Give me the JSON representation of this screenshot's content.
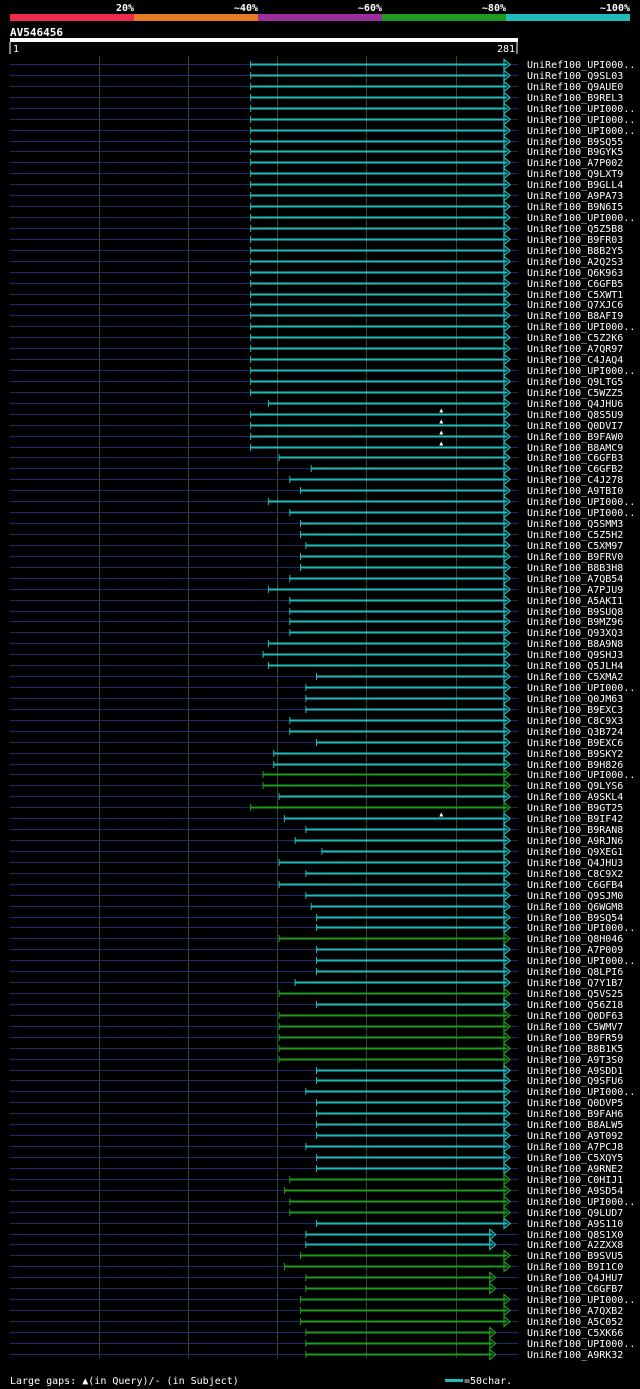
{
  "chart_data": {
    "type": "alignment-overview",
    "query_name": "AV546456",
    "query_start": 1,
    "query_end": 281,
    "start_label": "1",
    "end_label": "281",
    "identity_scale": {
      "ticks": [
        "20%",
        "~40%",
        "~60%",
        "~80%",
        "~100%"
      ],
      "colors": [
        "#ee2b4a",
        "#e87a22",
        "#9b2f9d",
        "#1f9a1f",
        "#1fbcbc"
      ]
    },
    "colors": {
      "background": "#000000",
      "query_bar": "#ffffff",
      "unaligned_line": "#1c2a6e",
      "grid": "#2a4f2a"
    },
    "hits": [
      {
        "name": "UniRef100_UPI000..",
        "start": 136,
        "end": 281,
        "color": "cyan",
        "arrow": true
      },
      {
        "name": "UniRef100_Q9SL03",
        "start": 136,
        "end": 281,
        "color": "cyan",
        "arrow": true
      },
      {
        "name": "UniRef100_Q9AUE0",
        "start": 136,
        "end": 281,
        "color": "cyan",
        "arrow": true
      },
      {
        "name": "UniRef100_B9REL3",
        "start": 136,
        "end": 281,
        "color": "cyan",
        "arrow": true
      },
      {
        "name": "UniRef100_UPI000..",
        "start": 136,
        "end": 281,
        "color": "cyan",
        "arrow": true
      },
      {
        "name": "UniRef100_UPI000..",
        "start": 136,
        "end": 281,
        "color": "cyan",
        "arrow": true
      },
      {
        "name": "UniRef100_UPI000..",
        "start": 136,
        "end": 281,
        "color": "cyan",
        "arrow": true
      },
      {
        "name": "UniRef100_B9SQ55",
        "start": 136,
        "end": 281,
        "color": "cyan",
        "arrow": true
      },
      {
        "name": "UniRef100_B9GYK5",
        "start": 136,
        "end": 281,
        "color": "cyan",
        "arrow": true
      },
      {
        "name": "UniRef100_A7P002",
        "start": 136,
        "end": 281,
        "color": "cyan",
        "arrow": true
      },
      {
        "name": "UniRef100_Q9LXT9",
        "start": 136,
        "end": 281,
        "color": "cyan",
        "arrow": true
      },
      {
        "name": "UniRef100_B9GLL4",
        "start": 136,
        "end": 281,
        "color": "cyan",
        "arrow": true
      },
      {
        "name": "UniRef100_A9PA73",
        "start": 136,
        "end": 281,
        "color": "cyan",
        "arrow": true
      },
      {
        "name": "UniRef100_B9N6I5",
        "start": 136,
        "end": 281,
        "color": "cyan",
        "arrow": true
      },
      {
        "name": "UniRef100_UPI000..",
        "start": 136,
        "end": 281,
        "color": "cyan",
        "arrow": true
      },
      {
        "name": "UniRef100_Q5Z5B8",
        "start": 136,
        "end": 281,
        "color": "cyan",
        "arrow": true
      },
      {
        "name": "UniRef100_B9FR03",
        "start": 136,
        "end": 281,
        "color": "cyan",
        "arrow": true
      },
      {
        "name": "UniRef100_B8B2Y5",
        "start": 136,
        "end": 281,
        "color": "cyan",
        "arrow": true
      },
      {
        "name": "UniRef100_A2Q2S3",
        "start": 136,
        "end": 281,
        "color": "cyan",
        "arrow": true
      },
      {
        "name": "UniRef100_Q6K963",
        "start": 136,
        "end": 281,
        "color": "cyan",
        "arrow": true
      },
      {
        "name": "UniRef100_C6GFB5",
        "start": 136,
        "end": 281,
        "color": "cyan",
        "arrow": true
      },
      {
        "name": "UniRef100_C5XWT1",
        "start": 136,
        "end": 281,
        "color": "cyan",
        "arrow": true
      },
      {
        "name": "UniRef100_Q7XJC6",
        "start": 136,
        "end": 281,
        "color": "cyan",
        "arrow": true
      },
      {
        "name": "UniRef100_B8AFI9",
        "start": 136,
        "end": 281,
        "color": "cyan",
        "arrow": true
      },
      {
        "name": "UniRef100_UPI000..",
        "start": 136,
        "end": 281,
        "color": "cyan",
        "arrow": true
      },
      {
        "name": "UniRef100_C5Z2K6",
        "start": 136,
        "end": 281,
        "color": "cyan",
        "arrow": true
      },
      {
        "name": "UniRef100_A7QR97",
        "start": 136,
        "end": 281,
        "color": "cyan",
        "arrow": true
      },
      {
        "name": "UniRef100_C4JAQ4",
        "start": 136,
        "end": 281,
        "color": "cyan",
        "arrow": true
      },
      {
        "name": "UniRef100_UPI000..",
        "start": 136,
        "end": 281,
        "color": "cyan",
        "arrow": true
      },
      {
        "name": "UniRef100_Q9LTG5",
        "start": 136,
        "end": 281,
        "color": "cyan",
        "arrow": true
      },
      {
        "name": "UniRef100_C5WZZ5",
        "start": 136,
        "end": 281,
        "color": "cyan",
        "arrow": true
      },
      {
        "name": "UniRef100_Q4JHU6",
        "start": 146,
        "end": 281,
        "color": "cyan",
        "arrow": true
      },
      {
        "name": "UniRef100_Q8S5U9",
        "start": 136,
        "end": 281,
        "color": "cyan",
        "arrow": true,
        "gap_query": 243
      },
      {
        "name": "UniRef100_Q0DVI7",
        "start": 136,
        "end": 281,
        "color": "cyan",
        "arrow": true,
        "gap_query": 243
      },
      {
        "name": "UniRef100_B9FAW0",
        "start": 136,
        "end": 281,
        "color": "cyan",
        "arrow": true,
        "gap_query": 243
      },
      {
        "name": "UniRef100_B8AMC9",
        "start": 136,
        "end": 281,
        "color": "cyan",
        "arrow": true,
        "gap_query": 243
      },
      {
        "name": "UniRef100_C6GFB3",
        "start": 152,
        "end": 281,
        "color": "cyan",
        "arrow": true
      },
      {
        "name": "UniRef100_C6GFB2",
        "start": 170,
        "end": 281,
        "color": "cyan",
        "arrow": true
      },
      {
        "name": "UniRef100_C4J278",
        "start": 158,
        "end": 281,
        "color": "cyan",
        "arrow": true
      },
      {
        "name": "UniRef100_A9TBI0",
        "start": 164,
        "end": 281,
        "color": "cyan",
        "arrow": true
      },
      {
        "name": "UniRef100_UPI000..",
        "start": 146,
        "end": 281,
        "color": "cyan",
        "arrow": true
      },
      {
        "name": "UniRef100_UPI000..",
        "start": 158,
        "end": 281,
        "color": "cyan",
        "arrow": true
      },
      {
        "name": "UniRef100_Q5SMM3",
        "start": 164,
        "end": 281,
        "color": "cyan",
        "arrow": true
      },
      {
        "name": "UniRef100_C5Z5H2",
        "start": 164,
        "end": 281,
        "color": "cyan",
        "arrow": true
      },
      {
        "name": "UniRef100_C5XM97",
        "start": 167,
        "end": 281,
        "color": "cyan",
        "arrow": true
      },
      {
        "name": "UniRef100_B9FRV0",
        "start": 164,
        "end": 281,
        "color": "cyan",
        "arrow": true
      },
      {
        "name": "UniRef100_B8B3H8",
        "start": 164,
        "end": 281,
        "color": "cyan",
        "arrow": true
      },
      {
        "name": "UniRef100_A7QB54",
        "start": 158,
        "end": 281,
        "color": "cyan",
        "arrow": true
      },
      {
        "name": "UniRef100_A7PJU9",
        "start": 146,
        "end": 281,
        "color": "cyan",
        "arrow": true
      },
      {
        "name": "UniRef100_A5AKI1",
        "start": 158,
        "end": 281,
        "color": "cyan",
        "arrow": true
      },
      {
        "name": "UniRef100_B9SUQ8",
        "start": 158,
        "end": 281,
        "color": "cyan",
        "arrow": true
      },
      {
        "name": "UniRef100_B9MZ96",
        "start": 158,
        "end": 281,
        "color": "cyan",
        "arrow": true
      },
      {
        "name": "UniRef100_Q93XQ3",
        "start": 158,
        "end": 281,
        "color": "cyan",
        "arrow": true
      },
      {
        "name": "UniRef100_B8A9N8",
        "start": 146,
        "end": 281,
        "color": "cyan",
        "arrow": true
      },
      {
        "name": "UniRef100_Q9SHJ3",
        "start": 143,
        "end": 281,
        "color": "cyan",
        "arrow": true
      },
      {
        "name": "UniRef100_Q5JLH4",
        "start": 146,
        "end": 281,
        "color": "cyan",
        "arrow": true
      },
      {
        "name": "UniRef100_C5XMA2",
        "start": 173,
        "end": 281,
        "color": "cyan",
        "arrow": true
      },
      {
        "name": "UniRef100_UPI000..",
        "start": 167,
        "end": 281,
        "color": "cyan",
        "arrow": true
      },
      {
        "name": "UniRef100_Q0JM63",
        "start": 167,
        "end": 281,
        "color": "cyan",
        "arrow": true
      },
      {
        "name": "UniRef100_B9EXC3",
        "start": 167,
        "end": 281,
        "color": "cyan",
        "arrow": true
      },
      {
        "name": "UniRef100_C8C9X3",
        "start": 158,
        "end": 281,
        "color": "cyan",
        "arrow": true
      },
      {
        "name": "UniRef100_Q3B724",
        "start": 158,
        "end": 281,
        "color": "cyan",
        "arrow": true
      },
      {
        "name": "UniRef100_B9EXC6",
        "start": 173,
        "end": 281,
        "color": "cyan",
        "arrow": true
      },
      {
        "name": "UniRef100_B9SKY2",
        "start": 149,
        "end": 281,
        "color": "cyan",
        "arrow": true
      },
      {
        "name": "UniRef100_B9H826",
        "start": 149,
        "end": 281,
        "color": "cyan",
        "arrow": true
      },
      {
        "name": "UniRef100_UPI000..",
        "start": 143,
        "end": 281,
        "color": "green",
        "arrow": true
      },
      {
        "name": "UniRef100_Q9LYS6",
        "start": 143,
        "end": 281,
        "color": "green",
        "arrow": true
      },
      {
        "name": "UniRef100_A9SKL4",
        "start": 152,
        "end": 281,
        "color": "cyan",
        "arrow": true
      },
      {
        "name": "UniRef100_B9GT25",
        "start": 136,
        "end": 281,
        "color": "green",
        "arrow": true
      },
      {
        "name": "UniRef100_B9IF42",
        "start": 155,
        "end": 281,
        "color": "cyan",
        "arrow": true,
        "gap_query": 243
      },
      {
        "name": "UniRef100_B9RAN8",
        "start": 167,
        "end": 281,
        "color": "cyan",
        "arrow": true
      },
      {
        "name": "UniRef100_A9RJN6",
        "start": 161,
        "end": 281,
        "color": "cyan",
        "arrow": true
      },
      {
        "name": "UniRef100_Q9XEG1",
        "start": 176,
        "end": 281,
        "color": "cyan",
        "arrow": true
      },
      {
        "name": "UniRef100_Q4JHU3",
        "start": 152,
        "end": 281,
        "color": "cyan",
        "arrow": true
      },
      {
        "name": "UniRef100_C8C9X2",
        "start": 167,
        "end": 281,
        "color": "cyan",
        "arrow": true
      },
      {
        "name": "UniRef100_C6GFB4",
        "start": 152,
        "end": 281,
        "color": "cyan",
        "arrow": true
      },
      {
        "name": "UniRef100_Q9SJM0",
        "start": 167,
        "end": 281,
        "color": "cyan",
        "arrow": true
      },
      {
        "name": "UniRef100_Q6WGM8",
        "start": 170,
        "end": 281,
        "color": "cyan",
        "arrow": true
      },
      {
        "name": "UniRef100_B9SQ54",
        "start": 173,
        "end": 281,
        "color": "cyan",
        "arrow": true
      },
      {
        "name": "UniRef100_UPI000..",
        "start": 173,
        "end": 281,
        "color": "cyan",
        "arrow": true
      },
      {
        "name": "UniRef100_Q8H046",
        "start": 152,
        "end": 281,
        "color": "green",
        "arrow": true
      },
      {
        "name": "UniRef100_A7P009",
        "start": 173,
        "end": 281,
        "color": "cyan",
        "arrow": true
      },
      {
        "name": "UniRef100_UPI000..",
        "start": 173,
        "end": 281,
        "color": "cyan",
        "arrow": true
      },
      {
        "name": "UniRef100_Q8LPI6",
        "start": 173,
        "end": 281,
        "color": "cyan",
        "arrow": true
      },
      {
        "name": "UniRef100_Q7Y1B7",
        "start": 161,
        "end": 281,
        "color": "cyan",
        "arrow": true
      },
      {
        "name": "UniRef100_Q5VS25",
        "start": 152,
        "end": 281,
        "color": "green",
        "arrow": true
      },
      {
        "name": "UniRef100_Q56Z18",
        "start": 173,
        "end": 281,
        "color": "cyan",
        "arrow": true
      },
      {
        "name": "UniRef100_Q0DF63",
        "start": 152,
        "end": 281,
        "color": "green",
        "arrow": true
      },
      {
        "name": "UniRef100_C5WMV7",
        "start": 152,
        "end": 281,
        "color": "green",
        "arrow": true
      },
      {
        "name": "UniRef100_B9FR59",
        "start": 152,
        "end": 281,
        "color": "green",
        "arrow": true
      },
      {
        "name": "UniRef100_B8B1K5",
        "start": 152,
        "end": 281,
        "color": "green",
        "arrow": true
      },
      {
        "name": "UniRef100_A9T3S0",
        "start": 152,
        "end": 281,
        "color": "green",
        "arrow": true
      },
      {
        "name": "UniRef100_A9SDD1",
        "start": 173,
        "end": 281,
        "color": "cyan",
        "arrow": true
      },
      {
        "name": "UniRef100_Q9SFU6",
        "start": 173,
        "end": 281,
        "color": "cyan",
        "arrow": true
      },
      {
        "name": "UniRef100_UPI000..",
        "start": 167,
        "end": 281,
        "color": "cyan",
        "arrow": true
      },
      {
        "name": "UniRef100_Q0DVP5",
        "start": 173,
        "end": 281,
        "color": "cyan",
        "arrow": true
      },
      {
        "name": "UniRef100_B9FAH6",
        "start": 173,
        "end": 281,
        "color": "cyan",
        "arrow": true
      },
      {
        "name": "UniRef100_B8ALW5",
        "start": 173,
        "end": 281,
        "color": "cyan",
        "arrow": true
      },
      {
        "name": "UniRef100_A9T092",
        "start": 173,
        "end": 281,
        "color": "cyan",
        "arrow": true
      },
      {
        "name": "UniRef100_A7PCJ8",
        "start": 167,
        "end": 281,
        "color": "cyan",
        "arrow": true
      },
      {
        "name": "UniRef100_C5XQY5",
        "start": 173,
        "end": 281,
        "color": "cyan",
        "arrow": true
      },
      {
        "name": "UniRef100_A9RNE2",
        "start": 173,
        "end": 281,
        "color": "cyan",
        "arrow": true
      },
      {
        "name": "UniRef100_C0HIJ1",
        "start": 158,
        "end": 281,
        "color": "green",
        "arrow": true
      },
      {
        "name": "UniRef100_A9SD54",
        "start": 155,
        "end": 281,
        "color": "green",
        "arrow": true
      },
      {
        "name": "UniRef100_UPI000..",
        "start": 158,
        "end": 281,
        "color": "green",
        "arrow": true
      },
      {
        "name": "UniRef100_Q9LUD7",
        "start": 158,
        "end": 281,
        "color": "green",
        "arrow": true
      },
      {
        "name": "UniRef100_A9S110",
        "start": 173,
        "end": 281,
        "color": "cyan",
        "arrow": true
      },
      {
        "name": "UniRef100_Q8S1X0",
        "start": 167,
        "end": 273,
        "color": "cyan",
        "arrow": true
      },
      {
        "name": "UniRef100_A2ZXX8",
        "start": 167,
        "end": 273,
        "color": "cyan",
        "arrow": true
      },
      {
        "name": "UniRef100_B9SVU5",
        "start": 164,
        "end": 281,
        "color": "green",
        "arrow": true
      },
      {
        "name": "UniRef100_B9I1C0",
        "start": 155,
        "end": 281,
        "color": "green",
        "arrow": true
      },
      {
        "name": "UniRef100_Q4JHU7",
        "start": 167,
        "end": 273,
        "color": "green",
        "arrow": true
      },
      {
        "name": "UniRef100_C6GFB7",
        "start": 167,
        "end": 273,
        "color": "green",
        "arrow": true
      },
      {
        "name": "UniRef100_UPI000..",
        "start": 164,
        "end": 281,
        "color": "green",
        "arrow": true
      },
      {
        "name": "UniRef100_A7QXB2",
        "start": 164,
        "end": 281,
        "color": "green",
        "arrow": true
      },
      {
        "name": "UniRef100_A5C052",
        "start": 164,
        "end": 281,
        "color": "green",
        "arrow": true
      },
      {
        "name": "UniRef100_C5XK66",
        "start": 167,
        "end": 273,
        "color": "green",
        "arrow": true
      },
      {
        "name": "UniRef100_UPI000..",
        "start": 167,
        "end": 273,
        "color": "green",
        "arrow": true
      },
      {
        "name": "UniRef100_A9RK32",
        "start": 167,
        "end": 273,
        "color": "green",
        "arrow": true
      }
    ]
  },
  "footer": {
    "large_gaps_label": "Large gaps: ",
    "query_gap_symbol": "▲",
    "query_gap_text": "(in Query)",
    "subject_gap_text": "/- (in Subject)",
    "scale_text": "=50char."
  }
}
